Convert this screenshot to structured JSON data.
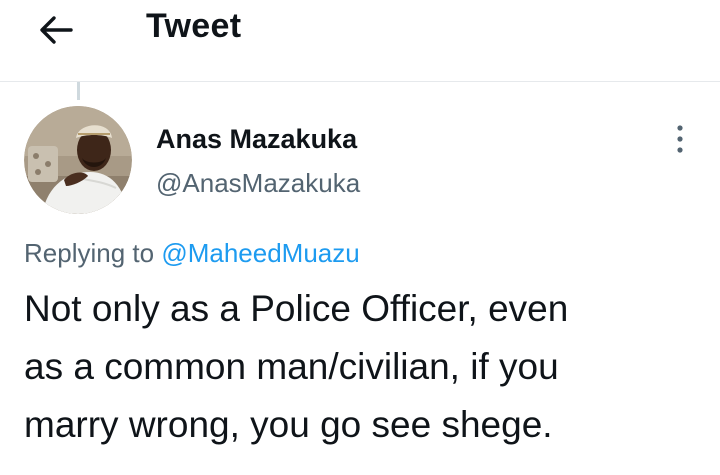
{
  "header": {
    "back_icon": "arrow-left-icon",
    "title": "Tweet"
  },
  "tweet": {
    "author": {
      "display_name": "Anas Mazakuka",
      "handle": "@AnasMazakuka",
      "avatar_icon": "user-photo-avatar"
    },
    "more_icon": "more-vertical-icon",
    "replying_prefix": "Replying to",
    "replying_to": "@MaheedMuazu",
    "text_lines": [
      "Not only as a Police Officer, even",
      "as a common man/civilian, if you",
      "marry wrong, you go see shege."
    ]
  },
  "colors": {
    "text": "#0f1419",
    "secondary": "#536471",
    "link": "#1d9bf0",
    "divider": "#e6e9ec",
    "thread_line": "#cfd9de"
  }
}
